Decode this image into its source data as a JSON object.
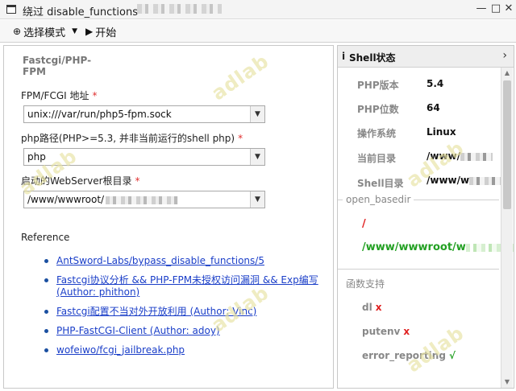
{
  "window": {
    "title": "绕过 disable_functions",
    "close": "✕",
    "maximize": "□",
    "minimize": "—"
  },
  "toolbar": {
    "mode_label": "选择模式",
    "start_label": "开始"
  },
  "left": {
    "section_title": "Fastcgi/PHP-FPM",
    "fields": [
      {
        "label": "FPM/FCGI 地址",
        "required": "*",
        "value": "unix:///var/run/php5-fpm.sock"
      },
      {
        "label": "php路径(PHP>=5.3, 并非当前运行的shell php)",
        "required": "*",
        "value": "php"
      },
      {
        "label": "启动的WebServer根目录",
        "required": "*",
        "value": "/www/wwwroot/"
      }
    ],
    "reference_heading": "Reference",
    "references": [
      "AntSword-Labs/bypass_disable_functions/5",
      "Fastcgi协议分析 && PHP-FPM未授权访问漏洞 && Exp编写 (Author: phithon)",
      "Fastcgi配置不当对外开放利用 (Author: Vinc)",
      "PHP-FastCGI-Client (Author: adoy)",
      "wofeiwo/fcgi_jailbreak.php"
    ]
  },
  "right": {
    "title": "Shell状态",
    "info": [
      {
        "key": "PHP版本",
        "value": "5.4"
      },
      {
        "key": "PHP位数",
        "value": "64"
      },
      {
        "key": "操作系统",
        "value": "Linux"
      },
      {
        "key": "当前目录",
        "value": "/www/"
      },
      {
        "key": "Shell目录",
        "value": "/www/w"
      }
    ],
    "open_basedir_label": "open_basedir",
    "open_basedir_paths": [
      "/",
      "/www/wwwroot/w"
    ],
    "functions_label": "函数支持",
    "functions": [
      {
        "name": "dl",
        "mark": "x",
        "color": "#e02020"
      },
      {
        "name": "putenv",
        "mark": "x",
        "color": "#e02020"
      },
      {
        "name": "error_reporting",
        "mark": "√",
        "color": "#22a022"
      }
    ],
    "path_colors": [
      "#e02020",
      "#22a022"
    ]
  },
  "watermark": "adlab"
}
